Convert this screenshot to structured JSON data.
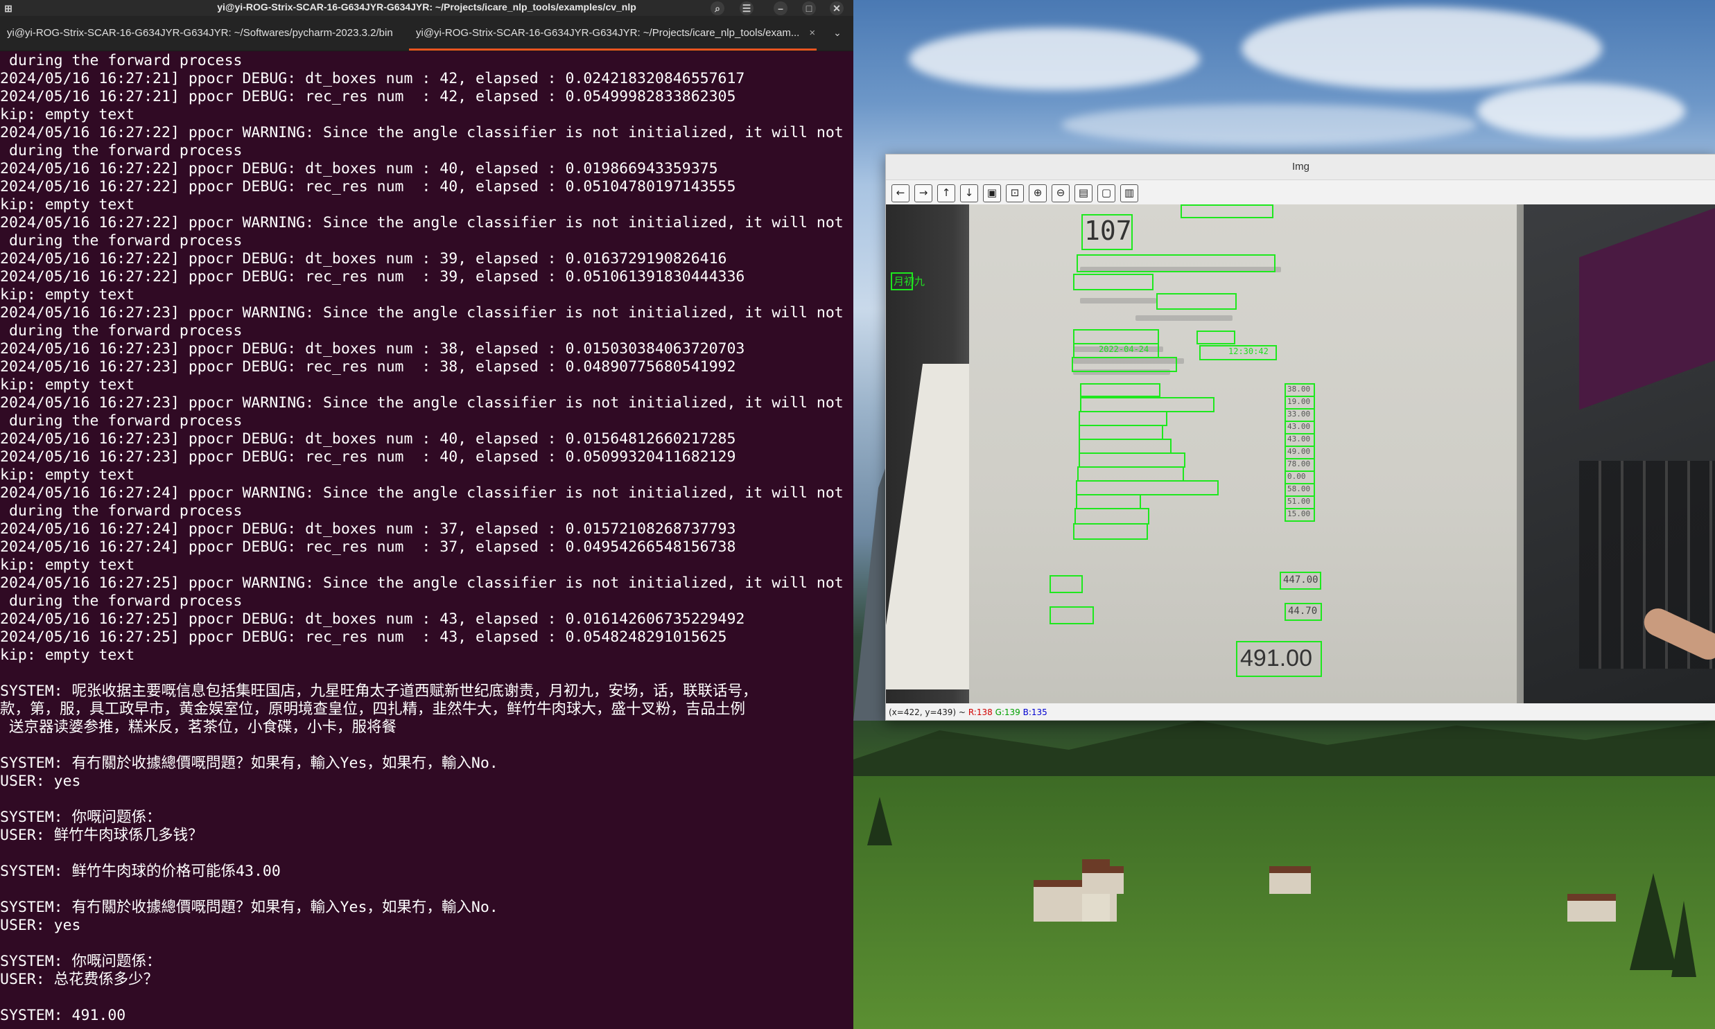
{
  "terminal": {
    "title": "yi@yi-ROG-Strix-SCAR-16-G634JYR-G634JYR: ~/Projects/icare_nlp_tools/examples/cv_nlp",
    "tabs": [
      {
        "label": "yi@yi-ROG-Strix-SCAR-16-G634JYR-G634JYR: ~/Softwares/pycharm-2023.3.2/bin"
      },
      {
        "label": "yi@yi-ROG-Strix-SCAR-16-G634JYR-G634JYR: ~/Projects/icare_nlp_tools/exam..."
      }
    ],
    "lines": [
      " during the forward process",
      "2024/05/16 16:27:21] ppocr DEBUG: dt_boxes num : 42, elapsed : 0.024218320846557617",
      "2024/05/16 16:27:21] ppocr DEBUG: rec_res num  : 42, elapsed : 0.05499982833862305",
      "kip: empty text",
      "2024/05/16 16:27:22] ppocr WARNING: Since the angle classifier is not initialized, it will not be use",
      " during the forward process",
      "2024/05/16 16:27:22] ppocr DEBUG: dt_boxes num : 40, elapsed : 0.019866943359375",
      "2024/05/16 16:27:22] ppocr DEBUG: rec_res num  : 40, elapsed : 0.05104780197143555",
      "kip: empty text",
      "2024/05/16 16:27:22] ppocr WARNING: Since the angle classifier is not initialized, it will not be use",
      " during the forward process",
      "2024/05/16 16:27:22] ppocr DEBUG: dt_boxes num : 39, elapsed : 0.0163729190826416",
      "2024/05/16 16:27:22] ppocr DEBUG: rec_res num  : 39, elapsed : 0.051061391830444336",
      "kip: empty text",
      "2024/05/16 16:27:23] ppocr WARNING: Since the angle classifier is not initialized, it will not be use",
      " during the forward process",
      "2024/05/16 16:27:23] ppocr DEBUG: dt_boxes num : 38, elapsed : 0.015030384063720703",
      "2024/05/16 16:27:23] ppocr DEBUG: rec_res num  : 38, elapsed : 0.04890775680541992",
      "kip: empty text",
      "2024/05/16 16:27:23] ppocr WARNING: Since the angle classifier is not initialized, it will not be use",
      " during the forward process",
      "2024/05/16 16:27:23] ppocr DEBUG: dt_boxes num : 40, elapsed : 0.01564812660217285",
      "2024/05/16 16:27:23] ppocr DEBUG: rec_res num  : 40, elapsed : 0.05099320411682129",
      "kip: empty text",
      "2024/05/16 16:27:24] ppocr WARNING: Since the angle classifier is not initialized, it will not be use",
      " during the forward process",
      "2024/05/16 16:27:24] ppocr DEBUG: dt_boxes num : 37, elapsed : 0.01572108268737793",
      "2024/05/16 16:27:24] ppocr DEBUG: rec_res num  : 37, elapsed : 0.04954266548156738",
      "kip: empty text",
      "2024/05/16 16:27:25] ppocr WARNING: Since the angle classifier is not initialized, it will not be use",
      " during the forward process",
      "2024/05/16 16:27:25] ppocr DEBUG: dt_boxes num : 43, elapsed : 0.016142606735229492",
      "2024/05/16 16:27:25] ppocr DEBUG: rec_res num  : 43, elapsed : 0.0548248291015625",
      "kip: empty text",
      "",
      "SYSTEM: 呢张收据主要嘅信息包括集旺国店，九星旺角太子道西赋新世纪底谢责，月初九，安场，话，联联话号，",
      "款，第，服，具工政早市，黄金娱室位，原明境查皇位，四扎精，韭然牛大，鲜竹牛肉球大，盛十叉粉，吉品土例",
      " 送京器读婆参推，糕米反，茗茶位，小食碟，小卡，服将餐",
      "",
      "SYSTEM: 有冇關於收據總價嘅問題？如果有，輸入Yes，如果冇，輸入No.",
      "USER: yes",
      "",
      "SYSTEM: 你嘅问题係：",
      "USER: 鲜竹牛肉球係几多钱？",
      "",
      "SYSTEM: 鲜竹牛肉球的价格可能係43.00",
      "",
      "SYSTEM: 有冇關於收據總價嘅問題？如果有，輸入Yes，如果冇，輸入No.",
      "USER: yes",
      "",
      "SYSTEM: 你嘅问题係：",
      "USER: 总花费係多少？",
      "",
      "SYSTEM: 491.00"
    ]
  },
  "image_window": {
    "title": "Img",
    "toolbar": [
      "arrow-left-icon",
      "arrow-right-icon",
      "arrow-up-icon",
      "arrow-down-icon",
      "zoom-fit-icon",
      "zoom-original-icon",
      "zoom-in-icon",
      "zoom-out-icon",
      "save-icon",
      "copy-icon",
      "properties-icon"
    ],
    "status": {
      "coords": "(x=422, y=439) ~",
      "r": "R:138",
      "g": "G:139",
      "b": "B:135"
    },
    "ocr_texts": {
      "table_number": "107",
      "total": "491.00",
      "subtotal": "447.00",
      "service": "44.70",
      "prices": [
        "38.00",
        "19.00",
        "33.00",
        "43.00",
        "43.00",
        "49.00",
        "78.00",
        "0.00",
        "58.00",
        "51.00",
        "15.00"
      ],
      "date": "2022-04-24",
      "time": "12:30:42",
      "left_label": "月初九"
    }
  },
  "colors": {
    "terminal_bg": "#300a24",
    "tab_accent": "#e95420",
    "ocr_green": "#1ee81e"
  }
}
